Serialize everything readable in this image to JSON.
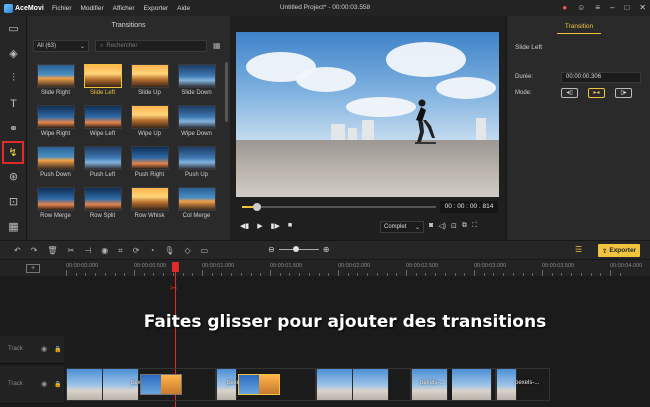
{
  "app": {
    "name": "AceMovi",
    "window_title": "Untitled Project* - 00:00:03.558",
    "menu": [
      "Fichier",
      "Modifier",
      "Afficher",
      "Exporter",
      "Aide"
    ]
  },
  "media_panel": {
    "title": "Transitions",
    "filter": "All (63)",
    "search_placeholder": "Rechercher",
    "items": [
      {
        "label": "Slide Right",
        "style": "t0",
        "selected": false
      },
      {
        "label": "Slide Left",
        "style": "t1",
        "selected": true
      },
      {
        "label": "Slide Up",
        "style": "t1",
        "selected": false
      },
      {
        "label": "Slide Down",
        "style": "t2",
        "selected": false
      },
      {
        "label": "Wipe Right",
        "style": "t3",
        "selected": false
      },
      {
        "label": "Wipe Left",
        "style": "t3",
        "selected": false
      },
      {
        "label": "Wipe Up",
        "style": "t1",
        "selected": false
      },
      {
        "label": "Wipe Down",
        "style": "t2",
        "selected": false
      },
      {
        "label": "Push Down",
        "style": "t0",
        "selected": false
      },
      {
        "label": "Push Left",
        "style": "t2",
        "selected": false
      },
      {
        "label": "Push Right",
        "style": "t3",
        "selected": false
      },
      {
        "label": "Push Up",
        "style": "t2",
        "selected": false
      },
      {
        "label": "Row Merge",
        "style": "t3",
        "selected": false
      },
      {
        "label": "Row Split",
        "style": "t3",
        "selected": false
      },
      {
        "label": "Row Whisk",
        "style": "t1",
        "selected": false
      },
      {
        "label": "Col Merge",
        "style": "t0",
        "selected": false
      }
    ]
  },
  "preview": {
    "timecode": "00 : 00 : 00 . 814",
    "progress": 0.23,
    "quality": "Complet"
  },
  "properties": {
    "tab": "Transition",
    "name": "Slide Left",
    "duration_label": "Durée:",
    "duration_value": "00:00:00.306",
    "mode_label": "Mode:"
  },
  "toolbar": {
    "export_label": "Exporter"
  },
  "ruler": {
    "labels": [
      "00:00:00.000",
      "00:00:00.500",
      "00:00:01.000",
      "00:00:01.500",
      "00:00:02.000",
      "00:00:02.500",
      "00:00:03.000",
      "00:00:03.500",
      "00:00:04.000"
    ]
  },
  "tracks": [
    {
      "name": "Track"
    },
    {
      "name": "Track"
    }
  ],
  "hint": "Faites glisser pour ajouter des transitions",
  "clip_label": "pexels-...",
  "colors": {
    "accent": "#f0c43c",
    "playhead": "#e02b2b"
  }
}
